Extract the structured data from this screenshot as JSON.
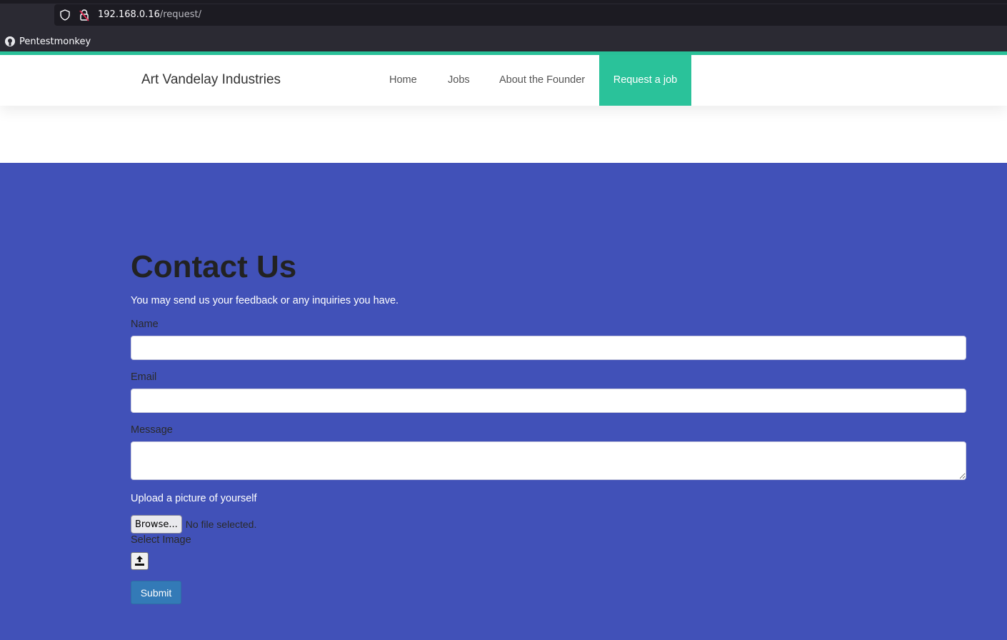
{
  "browser": {
    "url_host": "192.168.0.16",
    "url_path": "/request/",
    "bookmark_label": "Pentestmonkey"
  },
  "site": {
    "brand": "Art Vandelay Industries",
    "nav": {
      "home": "Home",
      "jobs": "Jobs",
      "about": "About the Founder",
      "request": "Request a job"
    }
  },
  "contact": {
    "title": "Contact Us",
    "lead": "You may send us your feedback or any inquiries you have.",
    "name_label": "Name",
    "name_value": "",
    "email_label": "Email",
    "email_value": "",
    "message_label": "Message",
    "message_value": "",
    "upload_label": "Upload a picture of yourself",
    "browse_label": "Browse...",
    "no_file_text": "No file selected.",
    "select_image_label": "Select Image",
    "submit_label": "Submit"
  },
  "colors": {
    "accent": "#2ac29a",
    "section_bg": "#4151b8",
    "submit_bg": "#337ab7"
  },
  "icons": {
    "shield": "shield-icon",
    "lock": "insecure-lock-icon",
    "bookmark": "github-icon",
    "upload": "upload-icon"
  }
}
